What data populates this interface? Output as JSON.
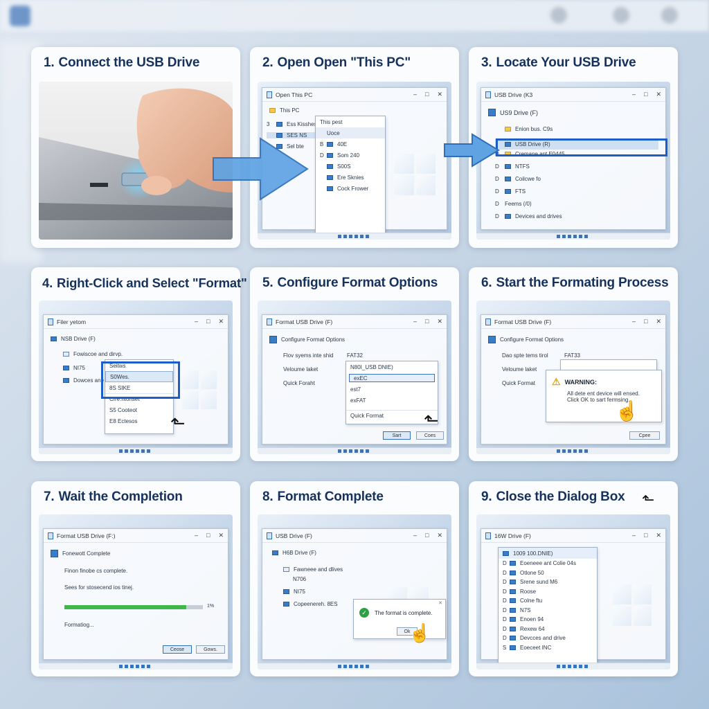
{
  "steps": [
    {
      "num": "1.",
      "title": "Connect the USB Drive"
    },
    {
      "num": "2.",
      "title": "Open Open \"This PC\""
    },
    {
      "num": "3.",
      "title": "Locate Your USB Drive"
    },
    {
      "num": "4.",
      "title": "Right-Click and Select \"Format\""
    },
    {
      "num": "5.",
      "title": "Configure Format Options"
    },
    {
      "num": "6.",
      "title": "Start the Formating Process"
    },
    {
      "num": "7.",
      "title": "Wait the Completion"
    },
    {
      "num": "8.",
      "title": "Format Complete"
    },
    {
      "num": "9.",
      "title": "Close the Dialog Box"
    }
  ],
  "s2": {
    "window_title": "Open This PC",
    "root": "This PC",
    "items": [
      {
        "mark": "3",
        "label": "Ess Kisshes"
      },
      {
        "mark": "",
        "label": "SES NS"
      },
      {
        "mark": "",
        "label": "Sel bte"
      }
    ],
    "panel": [
      "This pest",
      "Uoce",
      "40E",
      "Som 240",
      "S00S",
      "Ere Sknies",
      "Cock Frower"
    ],
    "panel_marks": [
      "",
      "",
      "B",
      "D",
      "",
      "",
      ""
    ]
  },
  "s3": {
    "window_title": "USB Drive (K3",
    "header": "US9 Drive (F)",
    "items": [
      {
        "mark": "",
        "label": "Enion bus. C9s"
      },
      {
        "mark": "",
        "label": "USB Drive (R)"
      },
      {
        "mark": "D",
        "label": "Cremane ant E0445"
      },
      {
        "mark": "D",
        "label": "NTFS"
      },
      {
        "mark": "D",
        "label": "Coilcwe fo"
      },
      {
        "mark": "D",
        "label": "FTS"
      },
      {
        "mark": "D",
        "label": "Feems (/0)"
      },
      {
        "mark": "D",
        "label": "Devices and drives"
      }
    ]
  },
  "s4": {
    "window_title": "Filer yetom",
    "header": "NSB Drive (F)",
    "items": [
      "Fowiscoe and dirvp.",
      "NI75",
      "Dowces ane dirves"
    ],
    "menu": [
      "Seitws",
      "S0Wes.",
      "8S  SIKE",
      "Cfre.ntonset",
      "S5  Cooteot",
      "E8  Ectesos"
    ]
  },
  "s5": {
    "window_title": "Format USB Drive (F)",
    "header": "Configure Format Options",
    "fields": [
      {
        "label": "Flov syems inte shid",
        "value": "FAT32"
      },
      {
        "label": "Veloume laket",
        "value": "N80I_USB DNIE)"
      },
      {
        "label": "Quick Foraht",
        "value": "exEC"
      }
    ],
    "options": [
      "est7",
      "exFAT",
      "Quick Format"
    ],
    "start": "Sart",
    "close": "Coes"
  },
  "s6": {
    "window_title": "Format USB Drive (F)",
    "header": "Configure Format Options",
    "fields": [
      {
        "label": "Dao spte tems tirol",
        "value": "FAT33"
      },
      {
        "label": "Veloume laket",
        "value": ""
      },
      {
        "label": "Quick Format",
        "value": ""
      }
    ],
    "warning_title": "WARNING:",
    "warning_l1": "All dete ent device will ensed.",
    "warning_l2": "Click OK to sart fermsing.",
    "close": "Cpee"
  },
  "s7": {
    "window_title": "Format USB Drive (F:)",
    "header": "Fonewott Complete",
    "line1": "Finon finobe cs complete.",
    "line2": "Sees for stosecend ios tinej.",
    "percent": "1%",
    "progress": 0.88,
    "status": "Formatiog...",
    "btn1": "Ceose",
    "btn2": "Gows."
  },
  "s8": {
    "window_title": "USB Drive (F)",
    "header": "H6B Drive (F)",
    "items": [
      "Fawneee and dlives",
      "N706",
      "NI75",
      "Copeenereh. 8ES"
    ],
    "msg": "The format is complete.",
    "ok": "Ok"
  },
  "s9": {
    "window_title": "16W Drive (F)",
    "header": "1009 100.DNIE)",
    "items": [
      {
        "mark": "D",
        "label": "Eoeneee ant Colie 04s"
      },
      {
        "mark": "D",
        "label": "Otlone 50"
      },
      {
        "mark": "D",
        "label": "Srene sund M6"
      },
      {
        "mark": "D",
        "label": "Roose"
      },
      {
        "mark": "D",
        "label": "Colne ftu"
      },
      {
        "mark": "D",
        "label": "N7S"
      },
      {
        "mark": "D",
        "label": "Enoen 94"
      },
      {
        "mark": "D",
        "label": "Rexew 64"
      },
      {
        "mark": "D",
        "label": "Devcces and drive"
      },
      {
        "mark": "S",
        "label": "Eoeceet INC"
      }
    ]
  }
}
